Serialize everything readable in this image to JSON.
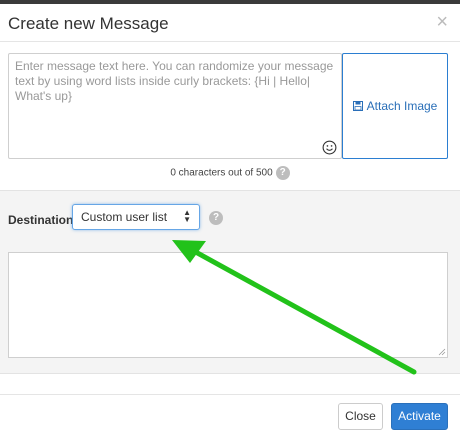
{
  "modal": {
    "title": "Create new Message",
    "close_symbol": "×"
  },
  "message": {
    "placeholder": "Enter message text here. You can randomize your message text by using word lists inside curly brackets: {Hi | Hello| What's up}",
    "value": "",
    "emoji_icon": "smiley-icon"
  },
  "attach": {
    "label": "Attach Image",
    "icon": "floppy-disk-icon"
  },
  "char_counter": {
    "text": "0 characters out of 500",
    "help_symbol": "?"
  },
  "destination": {
    "label": "Destination",
    "selected": "Custom user list",
    "help_symbol": "?"
  },
  "custom_list": {
    "value": ""
  },
  "footer": {
    "close_label": "Close",
    "activate_label": "Activate"
  },
  "colors": {
    "primary": "#2f7fd4",
    "annotation_arrow": "#22c21a"
  }
}
